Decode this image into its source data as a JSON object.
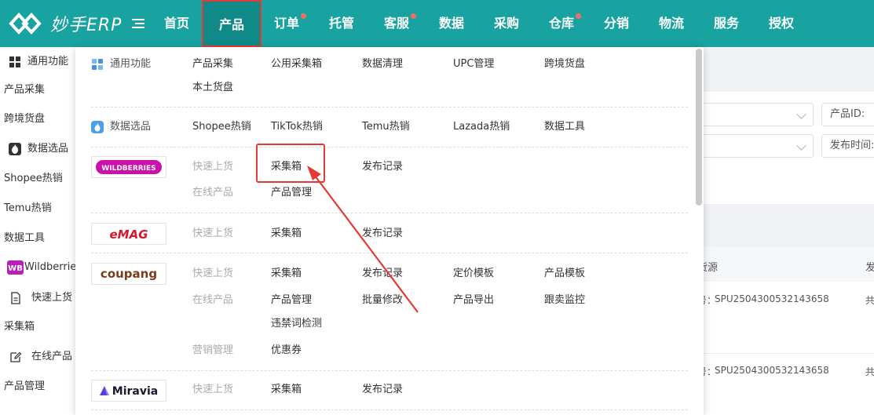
{
  "brand": {
    "name": "妙手ERP"
  },
  "nav": {
    "items": [
      {
        "label": "首页",
        "dot": false
      },
      {
        "label": "产品",
        "dot": false,
        "active": true
      },
      {
        "label": "订单",
        "dot": true
      },
      {
        "label": "托管",
        "dot": false
      },
      {
        "label": "客服",
        "dot": true
      },
      {
        "label": "数据",
        "dot": false
      },
      {
        "label": "采购",
        "dot": false
      },
      {
        "label": "仓库",
        "dot": true
      },
      {
        "label": "分销",
        "dot": false
      },
      {
        "label": "物流",
        "dot": false
      },
      {
        "label": "服务",
        "dot": false
      },
      {
        "label": "授权",
        "dot": false
      }
    ]
  },
  "sidebar": {
    "items": [
      {
        "label": "通用功能",
        "icon": "grid-icon"
      },
      {
        "label": "产品采集"
      },
      {
        "label": "跨境货盘"
      },
      {
        "label": "数据选品",
        "icon": "flame-icon"
      },
      {
        "label": "Shopee热销"
      },
      {
        "label": "Temu热销"
      },
      {
        "label": "数据工具"
      },
      {
        "label": "Wildberries",
        "icon": "wb-icon"
      },
      {
        "label": "快速上货",
        "icon": "document-icon"
      },
      {
        "label": "采集箱"
      },
      {
        "label": "在线产品",
        "icon": "edit-icon"
      },
      {
        "label": "产品管理"
      }
    ]
  },
  "background": {
    "product_id_label": "产品ID:",
    "publish_time_label": "发布时间:",
    "source_header": "货源",
    "fa_header": "发",
    "row1_spu": "SPU2504300532143658",
    "row2_spu": "SPU2504300532143658",
    "prefix": "号：",
    "gong": "共"
  },
  "dropdown": {
    "general": {
      "title": "通用功能",
      "links": [
        "产品采集",
        "公用采集箱",
        "数据清理",
        "UPC管理",
        "跨境货盘",
        "本土货盘"
      ]
    },
    "data_selection": {
      "title": "数据选品",
      "links": [
        "Shopee热销",
        "TikTok热销",
        "Temu热销",
        "Lazada热销",
        "数据工具"
      ]
    },
    "wildberries": {
      "logo": "WILDBERRIES",
      "labels": [
        "快速上货",
        "在线产品"
      ],
      "links": [
        "采集箱",
        "发布记录",
        "产品管理"
      ]
    },
    "emag": {
      "logo": "eMAG",
      "labels": [
        "快速上货"
      ],
      "links": [
        "采集箱",
        "发布记录"
      ]
    },
    "coupang": {
      "logo": "coupang",
      "labels": [
        "快速上货",
        "在线产品",
        "营销管理"
      ],
      "links": [
        "采集箱",
        "发布记录",
        "定价模板",
        "产品模板",
        "产品管理",
        "批量修改",
        "产品导出",
        "跟卖监控",
        "违禁词检测",
        "优惠券"
      ]
    },
    "miravia": {
      "logo": "Miravia",
      "labels": [
        "快速上货"
      ],
      "links": [
        "采集箱",
        "发布记录"
      ]
    }
  },
  "colors": {
    "header": "#18a2a0",
    "highlight": "#e53935",
    "nav_dot": "#f56c6c"
  }
}
